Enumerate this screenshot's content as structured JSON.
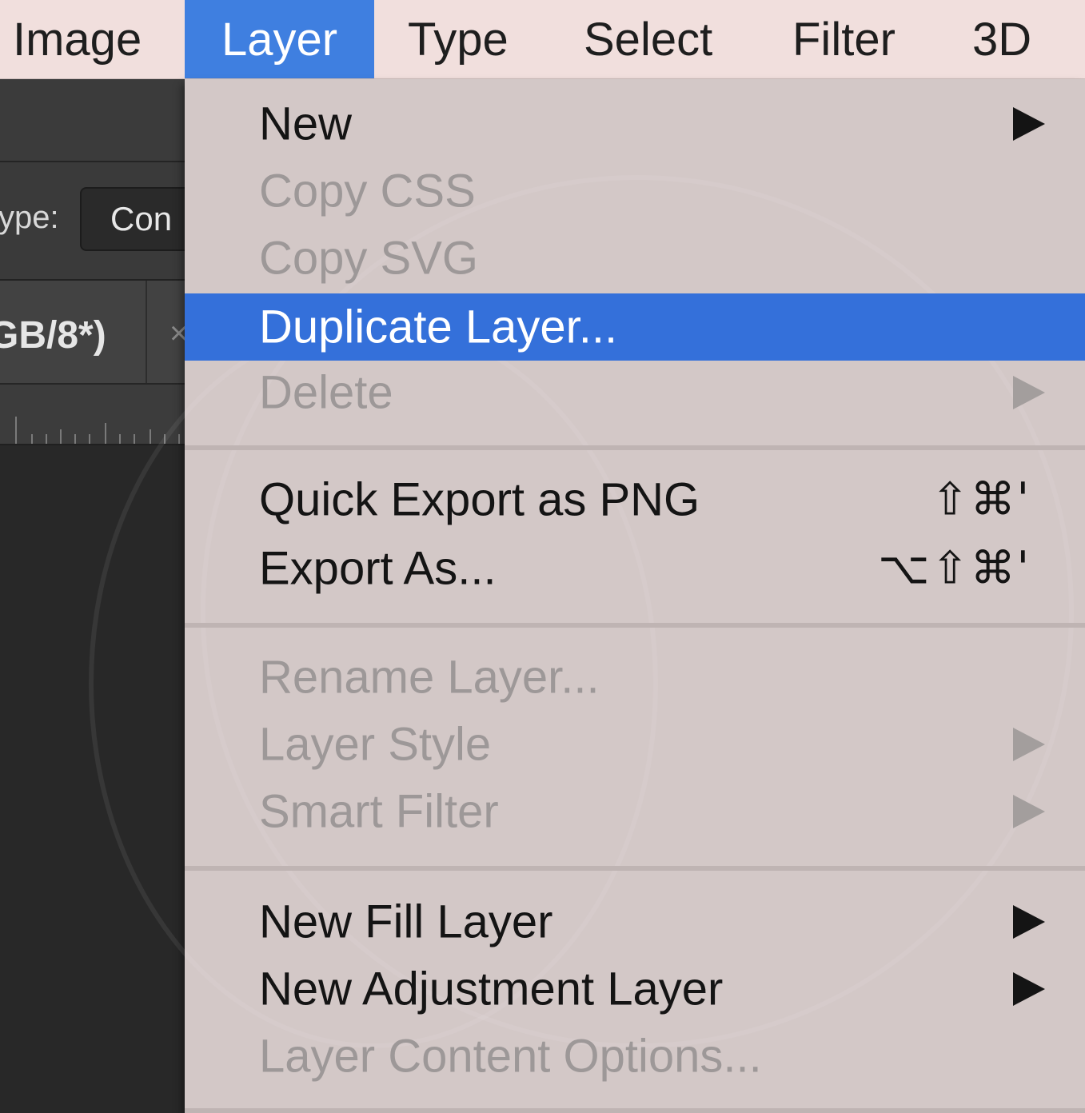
{
  "menubar": {
    "items": [
      {
        "label": "Image"
      },
      {
        "label": "Layer"
      },
      {
        "label": "Type"
      },
      {
        "label": "Select"
      },
      {
        "label": "Filter"
      },
      {
        "label": "3D"
      }
    ]
  },
  "background": {
    "type_label": "ype:",
    "type_value": "Con",
    "doc_tab_title": "GB/8*)",
    "doc_tab_close": "×"
  },
  "layer_menu": {
    "items": [
      {
        "label": "New",
        "enabled": true,
        "submenu": true
      },
      {
        "label": "Copy CSS",
        "enabled": false
      },
      {
        "label": "Copy SVG",
        "enabled": false
      },
      {
        "label": "Duplicate Layer...",
        "enabled": true,
        "highlighted": true
      },
      {
        "label": "Delete",
        "enabled": false,
        "submenu": true
      },
      {
        "label": "Quick Export as PNG",
        "enabled": true,
        "shortcut": "⇧⌘'"
      },
      {
        "label": "Export As...",
        "enabled": true,
        "shortcut": "⌥⇧⌘'"
      },
      {
        "label": "Rename Layer...",
        "enabled": false
      },
      {
        "label": "Layer Style",
        "enabled": false,
        "submenu": true
      },
      {
        "label": "Smart Filter",
        "enabled": false,
        "submenu": true
      },
      {
        "label": "New Fill Layer",
        "enabled": true,
        "submenu": true
      },
      {
        "label": "New Adjustment Layer",
        "enabled": true,
        "submenu": true
      },
      {
        "label": "Layer Content Options...",
        "enabled": false
      }
    ]
  },
  "colors": {
    "menubar_bg": "#f1dfdd",
    "active_menu_bg": "#3f7fe0",
    "highlight_bg": "#3470da",
    "menu_bg": "#d3c8c7",
    "disabled_text": "#9d9898"
  }
}
